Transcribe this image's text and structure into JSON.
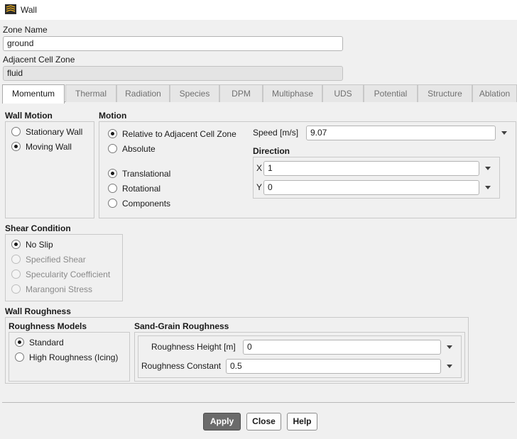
{
  "window": {
    "title": "Wall",
    "icon": "ansys-logo-icon"
  },
  "zone_name": {
    "label": "Zone Name",
    "value": "ground"
  },
  "adjacent_cell_zone": {
    "label": "Adjacent Cell Zone",
    "value": "fluid"
  },
  "tabs": [
    {
      "label": "Momentum",
      "active": true
    },
    {
      "label": "Thermal"
    },
    {
      "label": "Radiation"
    },
    {
      "label": "Species"
    },
    {
      "label": "DPM"
    },
    {
      "label": "Multiphase"
    },
    {
      "label": "UDS"
    },
    {
      "label": "Potential"
    },
    {
      "label": "Structure"
    },
    {
      "label": "Ablation"
    }
  ],
  "wall_motion": {
    "title": "Wall Motion",
    "options": [
      {
        "label": "Stationary Wall",
        "checked": false
      },
      {
        "label": "Moving Wall",
        "checked": true
      }
    ]
  },
  "motion": {
    "title": "Motion",
    "reference": [
      {
        "label": "Relative to Adjacent Cell Zone",
        "checked": true
      },
      {
        "label": "Absolute",
        "checked": false
      }
    ],
    "type": [
      {
        "label": "Translational",
        "checked": true
      },
      {
        "label": "Rotational",
        "checked": false
      },
      {
        "label": "Components",
        "checked": false
      }
    ],
    "speed": {
      "label": "Speed [m/s]",
      "value": "9.07"
    },
    "direction": {
      "title": "Direction",
      "x": {
        "label": "X",
        "value": "1"
      },
      "y": {
        "label": "Y",
        "value": "0"
      }
    }
  },
  "shear_condition": {
    "title": "Shear Condition",
    "options": [
      {
        "label": "No Slip",
        "checked": true,
        "enabled": true
      },
      {
        "label": "Specified Shear",
        "checked": false,
        "enabled": false
      },
      {
        "label": "Specularity Coefficient",
        "checked": false,
        "enabled": false
      },
      {
        "label": "Marangoni Stress",
        "checked": false,
        "enabled": false
      }
    ]
  },
  "wall_roughness": {
    "title": "Wall Roughness",
    "models": {
      "title": "Roughness Models",
      "options": [
        {
          "label": "Standard",
          "checked": true
        },
        {
          "label": "High Roughness (Icing)",
          "checked": false
        }
      ]
    },
    "sand_grain": {
      "title": "Sand-Grain Roughness",
      "height": {
        "label": "Roughness Height [m]",
        "value": "0"
      },
      "constant": {
        "label": "Roughness Constant",
        "value": "0.5"
      }
    }
  },
  "buttons": {
    "apply": "Apply",
    "close": "Close",
    "help": "Help"
  },
  "colors": {
    "primary_button": "#6b6b6b",
    "background": "#f0f0f0",
    "tab_active": "#ffffff"
  }
}
